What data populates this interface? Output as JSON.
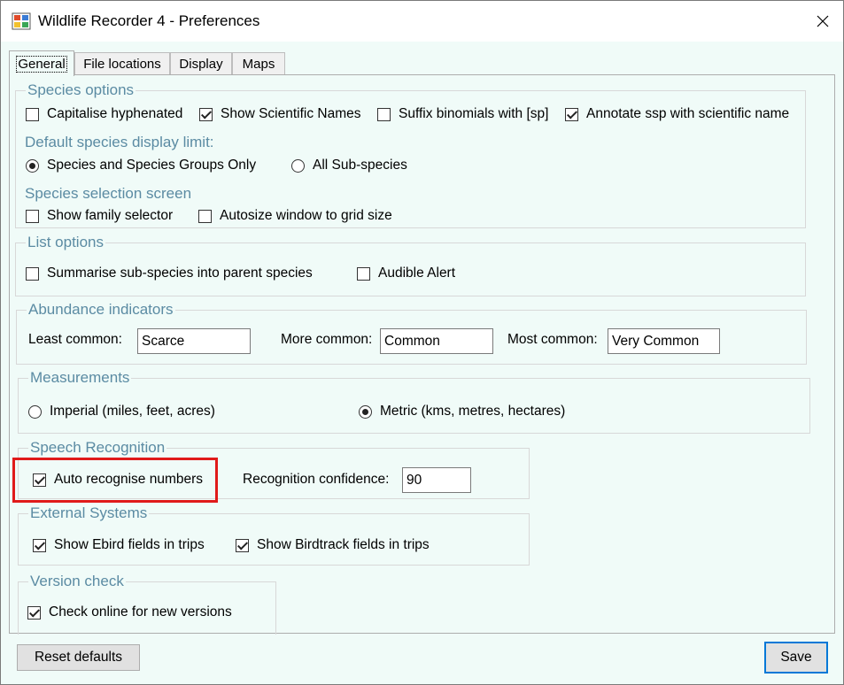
{
  "window": {
    "title": "Wildlife Recorder 4 - Preferences",
    "close_glyph": "✕"
  },
  "tabs": [
    "General",
    "File locations",
    "Display",
    "Maps"
  ],
  "species_options": {
    "title": "Species options",
    "checkboxes": [
      {
        "label": "Capitalise hyphenated",
        "checked": false
      },
      {
        "label": "Show Scientific Names",
        "checked": true
      },
      {
        "label": "Suffix binomials with [sp]",
        "checked": false
      },
      {
        "label": "Annotate ssp with scientific name",
        "checked": true
      }
    ],
    "display_limit_heading": "Default species display limit:",
    "radios": [
      {
        "label": "Species and Species Groups Only",
        "selected": true
      },
      {
        "label": "All Sub-species",
        "selected": false
      }
    ],
    "selection_screen_heading": "Species selection screen",
    "selection_checkboxes": [
      {
        "label": "Show family selector",
        "checked": false
      },
      {
        "label": "Autosize window to grid size",
        "checked": false
      }
    ]
  },
  "list_options": {
    "title": "List options",
    "checkboxes": [
      {
        "label": "Summarise sub-species into parent species",
        "checked": false
      },
      {
        "label": "Audible Alert",
        "checked": false
      }
    ]
  },
  "abundance": {
    "title": "Abundance indicators",
    "least_label": "Least common:",
    "least_value": "Scarce",
    "more_label": "More common:",
    "more_value": "Common",
    "most_label": "Most common:",
    "most_value": "Very Common"
  },
  "measurements": {
    "title": "Measurements",
    "radios": [
      {
        "label": "Imperial (miles, feet, acres)",
        "selected": false
      },
      {
        "label": "Metric (kms, metres, hectares)",
        "selected": true
      }
    ]
  },
  "speech": {
    "title": "Speech Recognition",
    "auto_label": "Auto recognise numbers",
    "auto_checked": true,
    "confidence_label": "Recognition confidence:",
    "confidence_value": "90"
  },
  "external": {
    "title": "External Systems",
    "checkboxes": [
      {
        "label": "Show Ebird fields in trips",
        "checked": true
      },
      {
        "label": "Show Birdtrack fields in trips",
        "checked": true
      }
    ]
  },
  "version": {
    "title": "Version check",
    "check_label": "Check online for new versions",
    "checked": true
  },
  "buttons": {
    "reset": "Reset defaults",
    "save": "Save"
  },
  "colors": {
    "panel_bg": "#f0fbf8",
    "group_title": "#5b8ba3",
    "highlight": "#e01a1a",
    "default_button_border": "#0078d7"
  }
}
